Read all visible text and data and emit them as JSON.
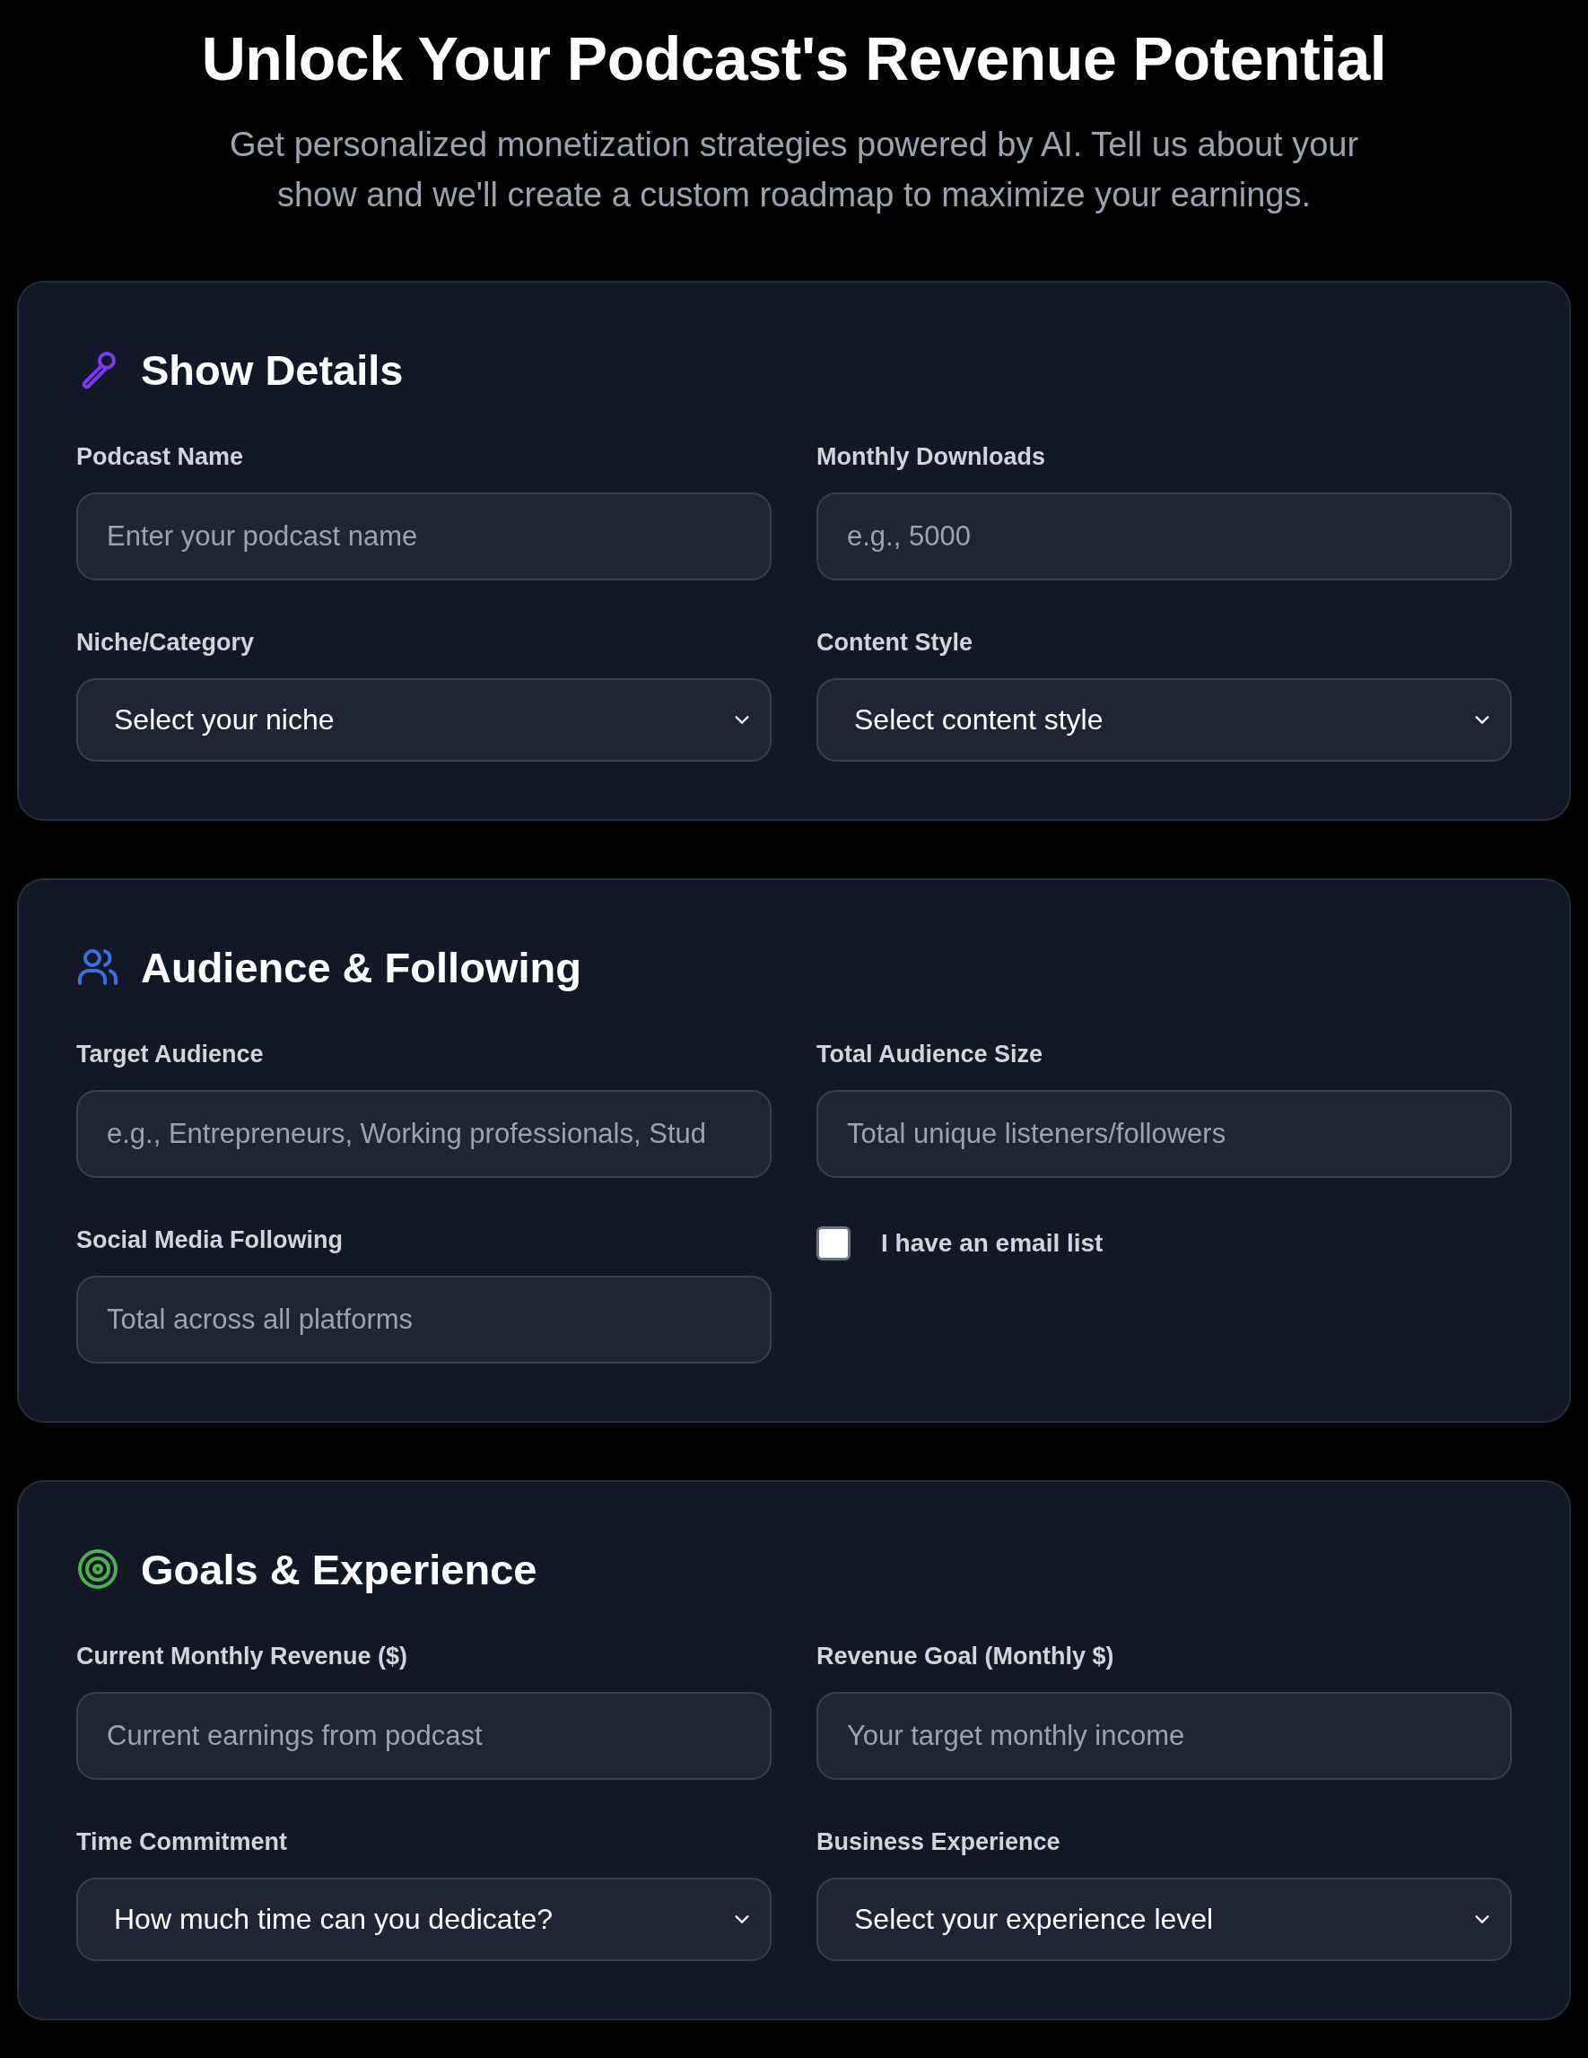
{
  "header": {
    "title": "Unlock Your Podcast's Revenue Potential",
    "subtitle": "Get personalized monetization strategies powered by AI. Tell us about your show and we'll create a custom roadmap to maximize your earnings."
  },
  "sections": [
    {
      "kind": "mic",
      "title": "Show Details",
      "fields": [
        {
          "kind": "input",
          "label": "Podcast Name",
          "placeholder": "Enter your podcast name"
        },
        {
          "kind": "input",
          "label": "Monthly Downloads",
          "placeholder": "e.g., 5000"
        },
        {
          "kind": "select",
          "label": "Niche/Category",
          "value": "Select your niche"
        },
        {
          "kind": "select",
          "label": "Content Style",
          "value": "Select content style"
        }
      ]
    },
    {
      "kind": "users",
      "title": "Audience & Following",
      "fields": [
        {
          "kind": "input",
          "label": "Target Audience",
          "placeholder": "e.g., Entrepreneurs, Working professionals, Stud"
        },
        {
          "kind": "input",
          "label": "Total Audience Size",
          "placeholder": "Total unique listeners/followers"
        },
        {
          "kind": "input",
          "label": "Social Media Following",
          "placeholder": "Total across all platforms"
        },
        {
          "kind": "checkbox",
          "label": "I have an email list",
          "checked": false
        }
      ]
    },
    {
      "kind": "target",
      "title": "Goals & Experience",
      "fields": [
        {
          "kind": "input",
          "label": "Current Monthly Revenue ($)",
          "placeholder": "Current earnings from podcast"
        },
        {
          "kind": "input",
          "label": "Revenue Goal (Monthly $)",
          "placeholder": "Your target monthly income"
        },
        {
          "kind": "select",
          "label": "Time Commitment",
          "value": "How much time can you dedicate?"
        },
        {
          "kind": "select",
          "label": "Business Experience",
          "value": "Select your experience level"
        }
      ]
    }
  ]
}
